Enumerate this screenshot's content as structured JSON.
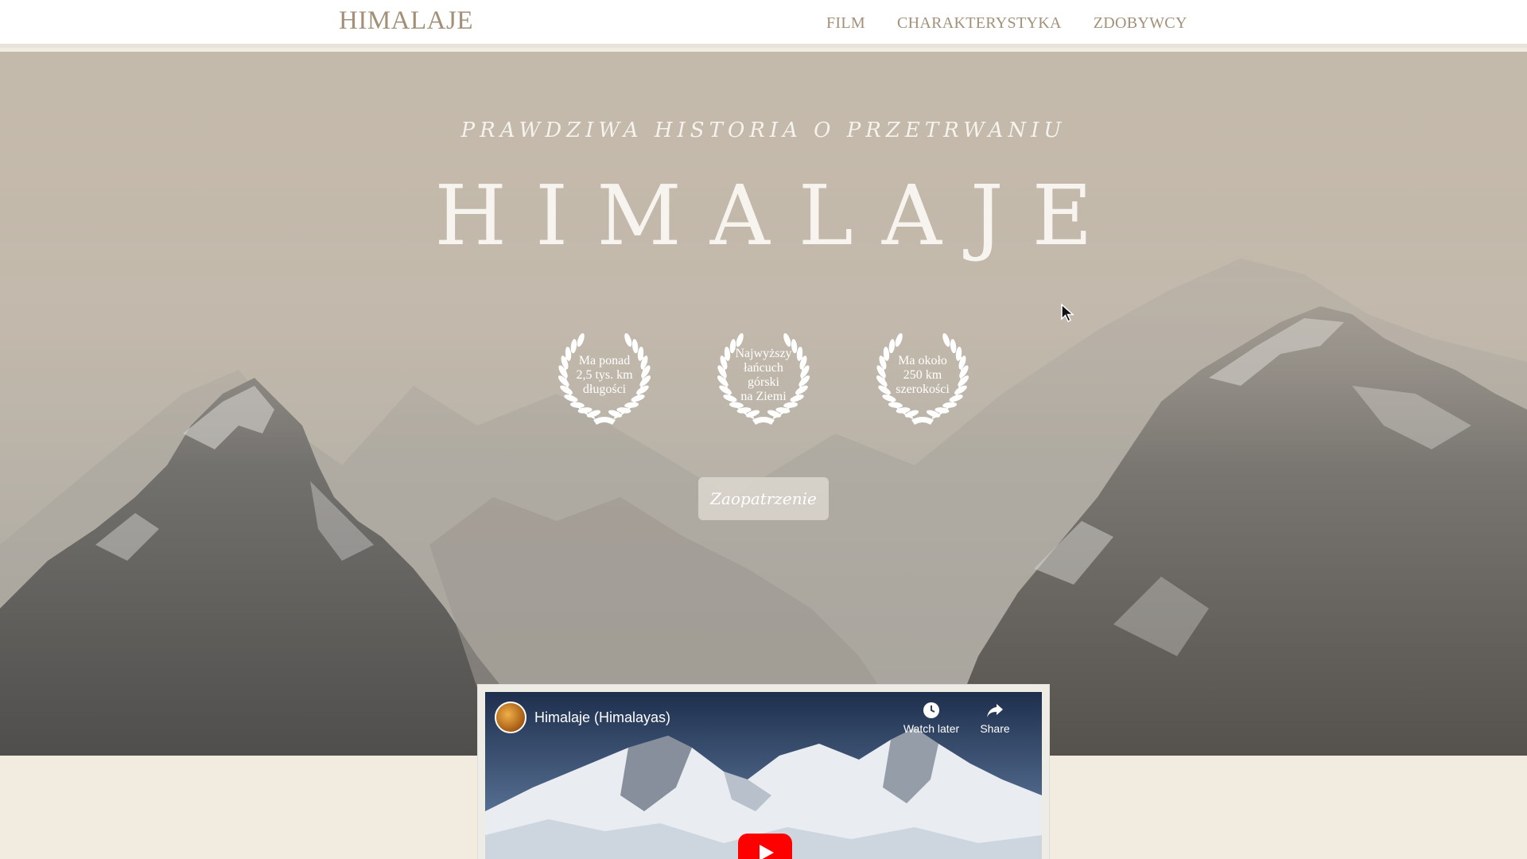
{
  "header": {
    "brand": "HIMALAJE",
    "nav": [
      "FILM",
      "CHARAKTERYSTYKA",
      "ZDOBYWCY"
    ]
  },
  "hero": {
    "tagline": "PRAWDZIWA HISTORIA O PRZETRWANIU",
    "title": "HIMALAJE",
    "laurels": [
      {
        "lines": [
          "Ma ponad",
          "2,5 tys. km",
          "długości"
        ]
      },
      {
        "lines": [
          "Najwyższy",
          "łańcuch",
          "górski",
          "na Ziemi"
        ]
      },
      {
        "lines": [
          "Ma około",
          "250 km",
          "szerokości"
        ]
      }
    ],
    "button": "Zaopatrzenie"
  },
  "video": {
    "title": "Himalaje (Himalayas)",
    "watch_later": "Watch later",
    "share": "Share"
  },
  "colors": {
    "nav_text": "#a39079",
    "page_bg": "#f1ebe0",
    "header_bg": "#ffffff",
    "youtube_red": "#ff0000"
  },
  "icons": [
    "laurel-wreath-icon",
    "clock-icon",
    "share-arrow-icon",
    "youtube-play-icon",
    "mouse-cursor-icon"
  ]
}
